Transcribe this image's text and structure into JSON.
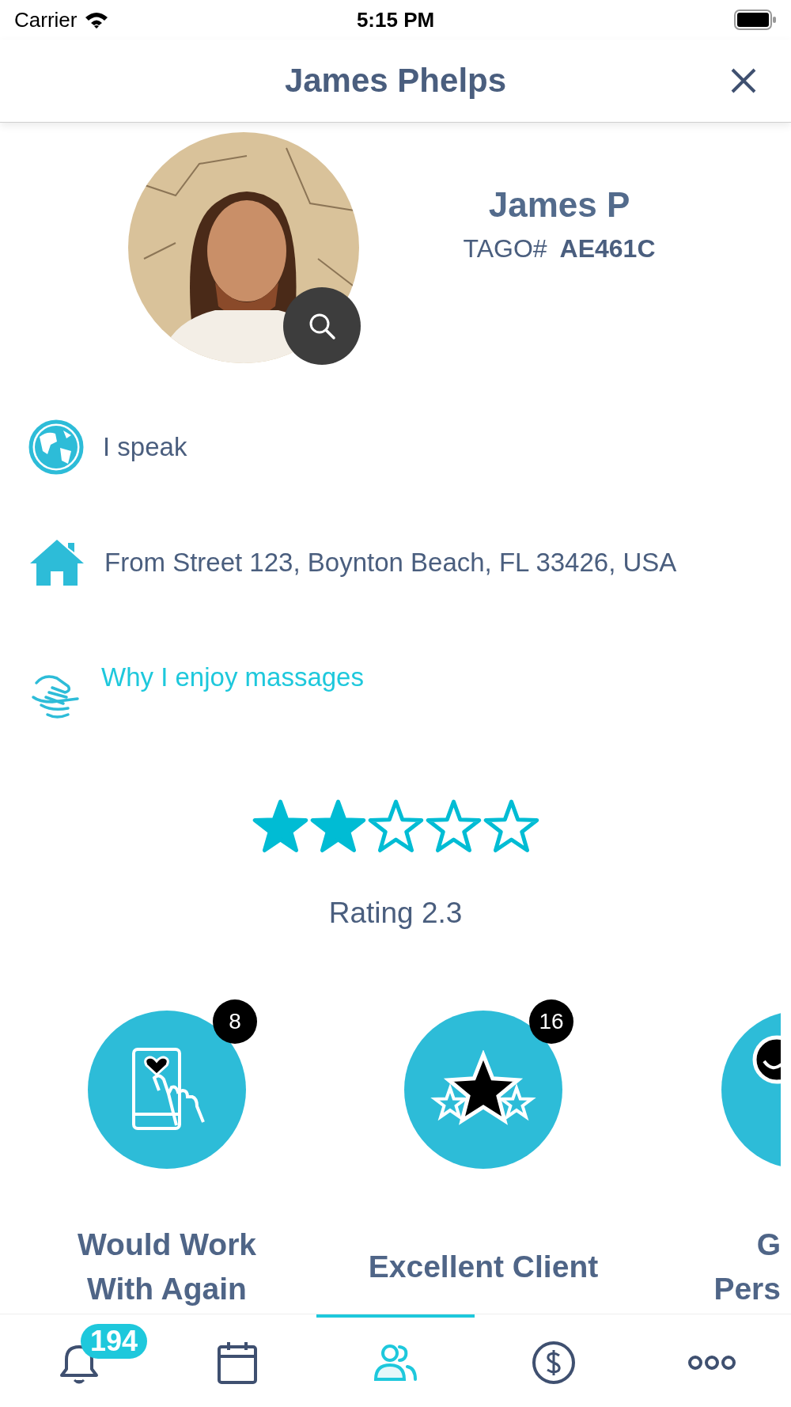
{
  "status_bar": {
    "carrier": "Carrier",
    "time": "5:15 PM"
  },
  "header": {
    "title": "James Phelps"
  },
  "profile": {
    "name": "James P",
    "tag_label": "TAGO#",
    "tag": "AE461C"
  },
  "info": [
    {
      "kind": "globe",
      "text": "I speak",
      "link": false
    },
    {
      "kind": "home",
      "text": "From Street 123, Boynton Beach, FL 33426, USA",
      "link": false
    },
    {
      "kind": "hands",
      "text": "Why I enjoy massages",
      "link": true
    }
  ],
  "rating": {
    "stars": 2,
    "text": "Rating 2.3"
  },
  "achievements": [
    {
      "kind": "phone-heart",
      "count": "8",
      "lines": [
        "Would Work",
        "With Again"
      ]
    },
    {
      "kind": "stars",
      "count": "16",
      "lines": [
        "Excellent Client"
      ]
    },
    {
      "kind": "smiley",
      "lines": [
        "G",
        "Pers"
      ]
    }
  ],
  "tabs": [
    {
      "kind": "bell",
      "selected": false,
      "badge": "194"
    },
    {
      "kind": "calendar",
      "selected": false
    },
    {
      "kind": "people",
      "selected": true
    },
    {
      "kind": "dollar",
      "selected": false
    },
    {
      "kind": "more",
      "selected": false
    }
  ]
}
